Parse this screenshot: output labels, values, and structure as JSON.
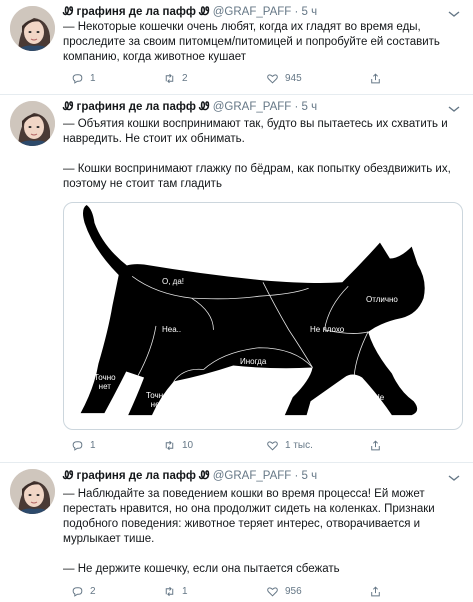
{
  "tweets": [
    {
      "display_name": "Ꮺ графиня де ла пафф Ꮺ",
      "handle": "@GRAF_PAFF",
      "time": "· 5 ч",
      "text": [
        "— Некоторые кошечки очень любят, когда их гладят во время еды, проследите за своим питомцем/питомицей и попробуйте ей составить компанию, когда животное кушает"
      ],
      "replies": "1",
      "retweets": "2",
      "likes": "945"
    },
    {
      "display_name": "Ꮺ графиня де ла пафф Ꮺ",
      "handle": "@GRAF_PAFF",
      "time": "· 5 ч",
      "text": [
        "— Объятия кошки воспринимают так, будто вы пытаетесь их схватить и навредить. Не стоит их обнимать.",
        "— Кошки воспринимают глажку по бёдрам, как попытку обездвижить их, поэтому не стоит там гладить"
      ],
      "replies": "1",
      "retweets": "10",
      "likes": "1 тыс."
    },
    {
      "display_name": "Ꮺ графиня де ла пафф Ꮺ",
      "handle": "@GRAF_PAFF",
      "time": "· 5 ч",
      "text": [
        "— Наблюдайте за поведением кошки во время процесса! Ей может перестать нравится, но она продолжит сидеть на коленках. Признаки подобного поведения: животное теряет интерес, отворачивается и мурлыкает тише.",
        "— Не держите кошечку, если она пытается сбежать"
      ],
      "replies": "2",
      "retweets": "1",
      "likes": "956"
    }
  ],
  "cat_image": {
    "labels": {
      "tail": "Не",
      "back": "О, да!",
      "head": "Отлично",
      "belly": "Неа..",
      "chest": "Не плохо",
      "middle": "Иногда",
      "rear_leg": "Точно\nнет",
      "hind_leg": "Точно\nнет",
      "front_leg1": "Не",
      "front_leg2": "Не"
    }
  },
  "icons": {
    "reply": "reply-icon",
    "retweet": "retweet-icon",
    "like": "heart-icon",
    "share": "share-icon",
    "more": "chevron-down-icon"
  },
  "colors": {
    "text": "#14171a",
    "secondary": "#657786",
    "divider": "#e6ecf0"
  }
}
